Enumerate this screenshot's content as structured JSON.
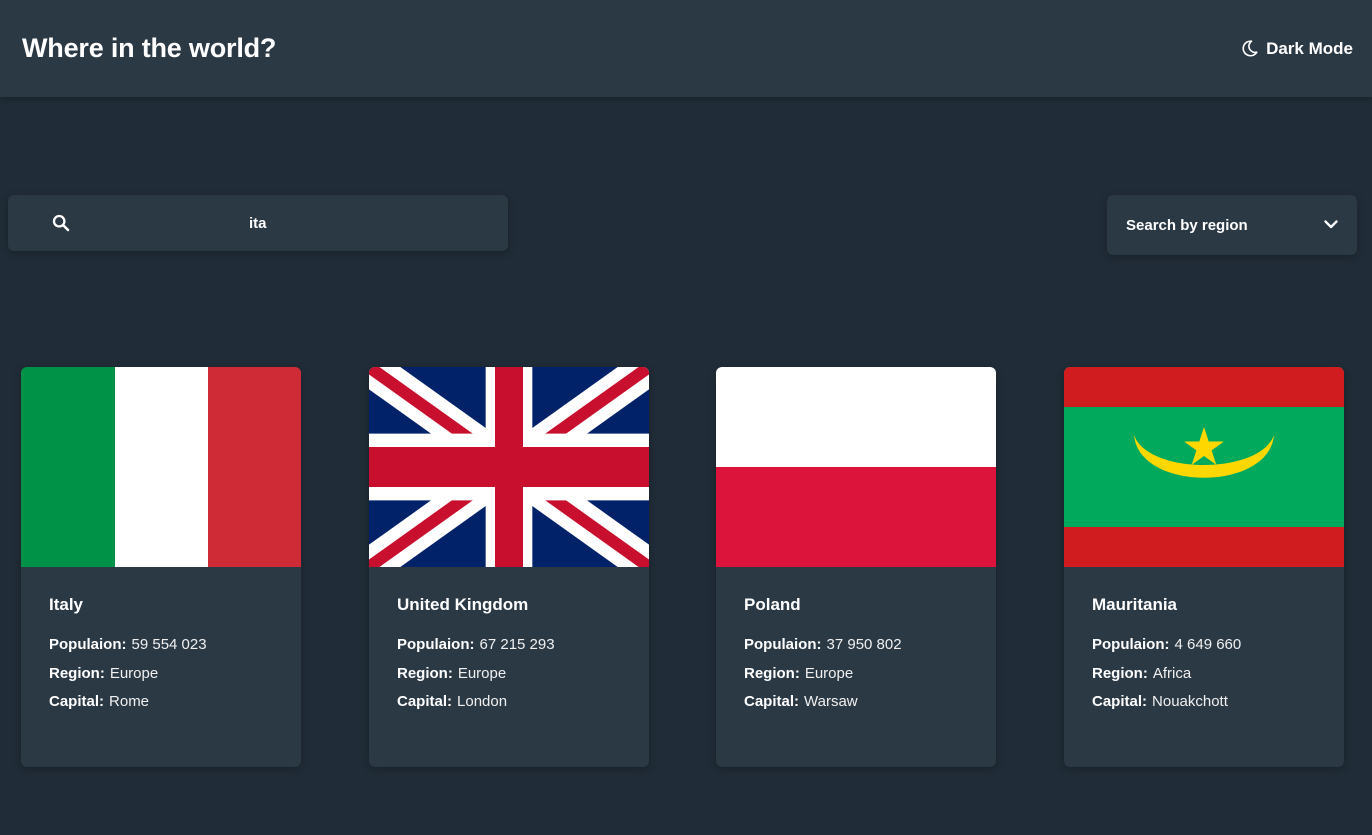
{
  "header": {
    "title": "Where in the world?",
    "mode_label": "Dark Mode"
  },
  "search": {
    "value": "ita",
    "icon": "search-icon"
  },
  "filter": {
    "label": "Search by region",
    "icon": "chevron-down-icon"
  },
  "labels": {
    "population": "Populaion:",
    "region": "Region:",
    "capital": "Capital:"
  },
  "countries": [
    {
      "name": "Italy",
      "population": "59 554 023",
      "region": "Europe",
      "capital": "Rome",
      "flag": "italy-flag"
    },
    {
      "name": "United Kingdom",
      "population": "67 215 293",
      "region": "Europe",
      "capital": "London",
      "flag": "uk-flag"
    },
    {
      "name": "Poland",
      "population": "37 950 802",
      "region": "Europe",
      "capital": "Warsaw",
      "flag": "poland-flag"
    },
    {
      "name": "Mauritania",
      "population": "4 649 660",
      "region": "Africa",
      "capital": "Nouakchott",
      "flag": "mauritania-flag"
    }
  ],
  "colors": {
    "background": "#202c37",
    "element": "#2b3945",
    "text": "#ffffff"
  }
}
